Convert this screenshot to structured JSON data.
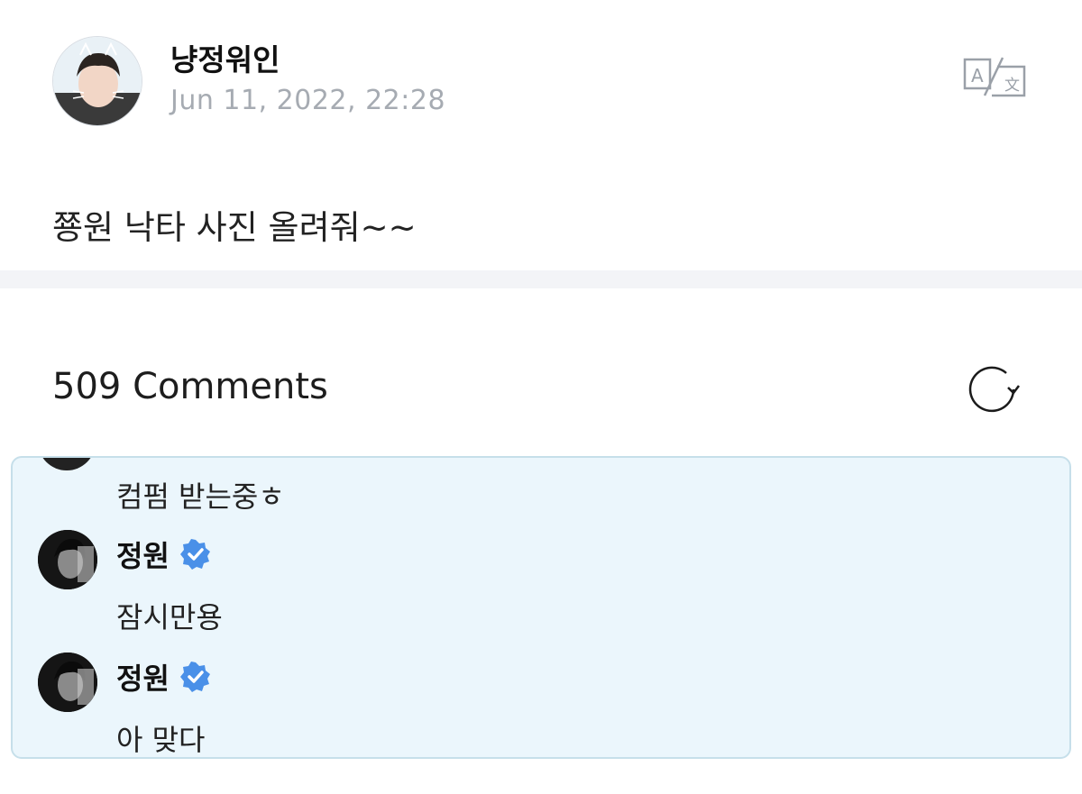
{
  "post": {
    "author_name": "냥정워인",
    "date": "Jun 11, 2022, 22:28",
    "body": "쭁원 낙타 사진 올려줘~~",
    "avatar_icon": "user-photo-avatar",
    "translate_icon": "translate-icon"
  },
  "comments_section": {
    "count_label": "509 Comments",
    "refresh_icon": "refresh-icon"
  },
  "comments": [
    {
      "text": "컴펌 받는중ㅎ"
    },
    {
      "author": "정원",
      "verified": true,
      "text": "잠시만용"
    },
    {
      "author": "정원",
      "verified": true,
      "text": "아 맞다"
    }
  ],
  "colors": {
    "verified_badge": "#4a90e8",
    "panel_background": "#ebf6fc",
    "panel_border": "#c6dfea",
    "date_text": "#a6abb2",
    "divider": "#f3f4f7"
  }
}
